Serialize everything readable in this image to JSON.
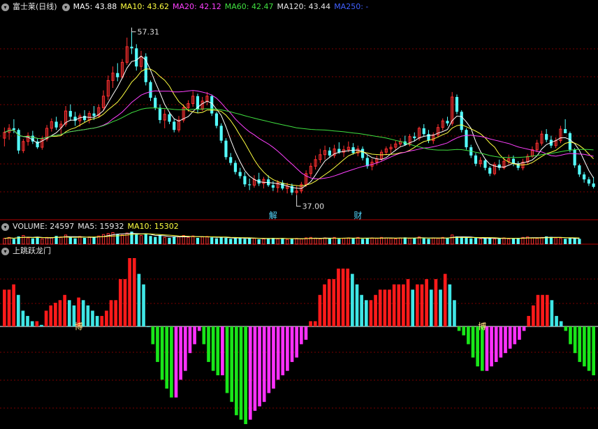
{
  "colors": {
    "up": "#ff3030",
    "down": "#54ffff",
    "ma5": "#ffffff",
    "ma10": "#ffff40",
    "ma20": "#ff40ff",
    "ma60": "#40e040",
    "ma120": "#dddddd",
    "ma250": "#4060ff",
    "ind_up_red": "#ff1a1a",
    "ind_up_cyan": "#3fe6e6",
    "ind_dn_green": "#19e619",
    "ind_dn_magenta": "#ff30ff"
  },
  "header": {
    "collapse_icon": "chevron-down-circle-icon",
    "title": "富士莱(日线)",
    "ma5": "MA5: 43.88",
    "ma10": "MA10: 43.62",
    "ma20": "MA20: 42.12",
    "ma60": "MA60: 42.47",
    "ma120": "MA120: 43.44",
    "ma250": "MA250: -"
  },
  "volume_header": {
    "vol": "VOLUME: 24597",
    "ma5": "MA5: 15932",
    "ma10": "MA10: 15302"
  },
  "indicator_header": {
    "title": "上跳跃龙门"
  },
  "chart_data": [
    {
      "type": "candlestick",
      "title": "富士莱(日线)",
      "price_range": [
        34.6,
        58.8
      ],
      "annotations": [
        {
          "label": "57.31",
          "kind": "high",
          "index": 27
        },
        {
          "label": "37.00",
          "kind": "low",
          "index": 62
        },
        {
          "label": "解",
          "index": 57
        },
        {
          "label": "财",
          "index": 75
        }
      ],
      "ohlc": [
        [
          43.9,
          45.2,
          42.9,
          44.6
        ],
        [
          44.6,
          45.6,
          43.7,
          45.1
        ],
        [
          45.1,
          46.2,
          44.5,
          44.9
        ],
        [
          44.9,
          45.1,
          42.0,
          42.4
        ],
        [
          42.4,
          43.8,
          42.1,
          43.5
        ],
        [
          43.5,
          44.6,
          43.0,
          44.2
        ],
        [
          44.2,
          44.8,
          43.2,
          43.5
        ],
        [
          43.5,
          43.9,
          42.6,
          42.8
        ],
        [
          42.8,
          44.1,
          42.5,
          43.8
        ],
        [
          43.8,
          45.5,
          43.5,
          45.1
        ],
        [
          45.1,
          46.3,
          44.7,
          45.9
        ],
        [
          45.9,
          46.5,
          44.9,
          45.2
        ],
        [
          45.2,
          46.0,
          44.2,
          45.6
        ],
        [
          45.6,
          47.8,
          45.3,
          47.2
        ],
        [
          47.2,
          48.0,
          46.0,
          46.5
        ],
        [
          46.5,
          47.1,
          45.4,
          46.0
        ],
        [
          46.0,
          46.9,
          45.3,
          46.6
        ],
        [
          46.6,
          47.3,
          45.8,
          46.1
        ],
        [
          46.1,
          47.2,
          45.7,
          46.9
        ],
        [
          46.9,
          47.8,
          46.1,
          46.6
        ],
        [
          46.6,
          48.0,
          46.4,
          47.6
        ],
        [
          47.6,
          49.7,
          47.2,
          49.0
        ],
        [
          49.0,
          51.5,
          48.5,
          50.9
        ],
        [
          50.9,
          52.6,
          50.0,
          51.8
        ],
        [
          51.8,
          53.0,
          50.8,
          51.3
        ],
        [
          51.3,
          53.5,
          51.1,
          53.1
        ],
        [
          53.1,
          56.1,
          52.8,
          55.0
        ],
        [
          55.0,
          57.31,
          54.1,
          54.8
        ],
        [
          54.8,
          55.3,
          52.1,
          52.6
        ],
        [
          52.6,
          54.5,
          52.1,
          53.8
        ],
        [
          53.8,
          54.2,
          50.3,
          50.7
        ],
        [
          50.7,
          50.9,
          48.4,
          48.8
        ],
        [
          48.8,
          49.1,
          47.3,
          47.6
        ],
        [
          47.6,
          48.0,
          45.7,
          46.1
        ],
        [
          46.1,
          47.4,
          45.1,
          46.8
        ],
        [
          46.8,
          47.1,
          45.6,
          45.9
        ],
        [
          45.9,
          46.3,
          44.6,
          44.9
        ],
        [
          44.9,
          46.6,
          44.6,
          46.1
        ],
        [
          46.1,
          48.0,
          45.8,
          47.6
        ],
        [
          47.6,
          48.5,
          47.1,
          48.1
        ],
        [
          48.1,
          49.6,
          47.7,
          49.0
        ],
        [
          49.0,
          49.3,
          47.0,
          47.4
        ],
        [
          47.4,
          48.9,
          47.2,
          48.4
        ],
        [
          48.4,
          49.5,
          47.9,
          49.0
        ],
        [
          49.0,
          49.2,
          46.6,
          46.9
        ],
        [
          46.9,
          47.1,
          45.1,
          45.4
        ],
        [
          45.4,
          45.7,
          43.3,
          43.6
        ],
        [
          43.6,
          43.9,
          41.3,
          41.6
        ],
        [
          41.6,
          42.1,
          40.6,
          40.9
        ],
        [
          40.9,
          41.2,
          39.5,
          39.8
        ],
        [
          39.8,
          40.3,
          39.0,
          39.3
        ],
        [
          39.3,
          39.8,
          38.0,
          38.3
        ],
        [
          38.3,
          39.0,
          37.6,
          38.2
        ],
        [
          38.2,
          39.4,
          37.9,
          38.9
        ],
        [
          38.9,
          39.7,
          38.1,
          38.4
        ],
        [
          38.4,
          39.2,
          37.8,
          38.9
        ],
        [
          38.9,
          39.4,
          38.0,
          38.2
        ],
        [
          38.2,
          38.7,
          37.5,
          37.9
        ],
        [
          37.9,
          38.8,
          37.3,
          38.5
        ],
        [
          38.5,
          38.8,
          37.6,
          37.8
        ],
        [
          37.8,
          38.5,
          37.2,
          38.1
        ],
        [
          38.1,
          38.4,
          37.0,
          37.3
        ],
        [
          37.3,
          38.1,
          37.0,
          37.5
        ],
        [
          37.5,
          38.6,
          37.2,
          38.3
        ],
        [
          38.3,
          40.0,
          38.0,
          39.6
        ],
        [
          39.6,
          40.9,
          39.2,
          40.5
        ],
        [
          40.5,
          41.8,
          40.1,
          41.3
        ],
        [
          41.3,
          42.6,
          40.9,
          41.9
        ],
        [
          41.9,
          43.0,
          41.3,
          42.4
        ],
        [
          42.4,
          42.8,
          41.5,
          41.8
        ],
        [
          41.8,
          43.1,
          41.5,
          42.6
        ],
        [
          42.6,
          43.4,
          42.0,
          42.2
        ],
        [
          42.2,
          43.0,
          41.6,
          42.5
        ],
        [
          42.5,
          43.5,
          42.2,
          42.8
        ],
        [
          42.8,
          43.3,
          41.9,
          42.1
        ],
        [
          42.1,
          43.0,
          41.7,
          42.6
        ],
        [
          42.6,
          42.9,
          41.2,
          41.5
        ],
        [
          41.5,
          41.9,
          40.2,
          40.5
        ],
        [
          40.5,
          41.4,
          40.0,
          41.0
        ],
        [
          41.0,
          41.8,
          40.6,
          41.4
        ],
        [
          41.4,
          42.5,
          41.1,
          42.2
        ],
        [
          42.2,
          42.9,
          41.8,
          42.6
        ],
        [
          42.6,
          43.2,
          42.1,
          42.8
        ],
        [
          42.8,
          43.6,
          42.4,
          43.2
        ],
        [
          43.2,
          43.9,
          42.8,
          43.5
        ],
        [
          43.5,
          44.2,
          43.0,
          43.1
        ],
        [
          43.1,
          44.4,
          42.9,
          44.1
        ],
        [
          44.1,
          44.6,
          43.5,
          43.9
        ],
        [
          43.9,
          45.3,
          43.6,
          45.1
        ],
        [
          45.1,
          45.6,
          44.1,
          44.4
        ],
        [
          44.4,
          44.9,
          43.3,
          43.6
        ],
        [
          43.6,
          44.6,
          43.2,
          44.3
        ],
        [
          44.3,
          45.6,
          44.0,
          45.2
        ],
        [
          45.2,
          46.3,
          44.8,
          46.0
        ],
        [
          46.0,
          46.5,
          45.4,
          45.7
        ],
        [
          45.7,
          49.5,
          45.4,
          48.9
        ],
        [
          48.9,
          49.2,
          46.8,
          47.1
        ],
        [
          47.1,
          47.3,
          44.6,
          44.9
        ],
        [
          44.9,
          45.1,
          42.5,
          42.8
        ],
        [
          42.8,
          43.1,
          41.5,
          41.8
        ],
        [
          41.8,
          42.1,
          40.5,
          40.8
        ],
        [
          40.8,
          41.6,
          40.4,
          41.2
        ],
        [
          41.2,
          41.4,
          40.0,
          40.3
        ],
        [
          40.3,
          40.5,
          39.3,
          39.6
        ],
        [
          39.6,
          41.0,
          39.4,
          40.7
        ],
        [
          40.7,
          41.3,
          40.0,
          40.3
        ],
        [
          40.3,
          41.6,
          40.1,
          41.1
        ],
        [
          41.1,
          41.9,
          40.7,
          41.4
        ],
        [
          41.4,
          41.8,
          40.5,
          40.8
        ],
        [
          40.8,
          41.1,
          40.0,
          40.3
        ],
        [
          40.3,
          41.4,
          40.0,
          41.0
        ],
        [
          41.0,
          42.0,
          40.7,
          41.7
        ],
        [
          41.7,
          42.9,
          41.5,
          42.5
        ],
        [
          42.5,
          43.7,
          42.2,
          43.3
        ],
        [
          43.3,
          44.8,
          43.0,
          44.4
        ],
        [
          44.4,
          45.0,
          43.4,
          43.7
        ],
        [
          43.7,
          44.2,
          42.7,
          43.0
        ],
        [
          43.0,
          44.0,
          42.7,
          43.6
        ],
        [
          43.6,
          45.4,
          43.3,
          45.0
        ],
        [
          45.0,
          46.2,
          44.5,
          44.5
        ],
        [
          44.5,
          44.7,
          42.2,
          42.5
        ],
        [
          42.5,
          42.7,
          40.3,
          40.6
        ],
        [
          40.6,
          40.8,
          39.2,
          39.5
        ],
        [
          39.5,
          39.8,
          38.5,
          38.9
        ],
        [
          38.9,
          39.2,
          38.1,
          38.4
        ],
        [
          38.4,
          39.2,
          37.8,
          38.0
        ]
      ]
    },
    {
      "type": "bar",
      "title": "VOLUME",
      "series": [
        {
          "name": "VOLUME",
          "values": [
            12,
            14,
            11,
            16,
            18,
            13,
            12,
            15,
            11,
            14,
            13,
            17,
            15,
            19,
            14,
            12,
            16,
            13,
            15,
            14,
            17,
            20,
            22,
            24,
            21,
            19,
            23,
            26,
            20,
            18,
            21,
            17,
            15,
            19,
            14,
            13,
            16,
            15,
            18,
            14,
            17,
            13,
            15,
            16,
            14,
            12,
            15,
            13,
            11,
            12,
            14,
            11,
            13,
            12,
            10,
            11,
            12,
            13,
            11,
            12,
            10,
            11,
            12,
            11,
            13,
            14,
            12,
            11,
            13,
            12,
            14,
            11,
            12,
            13,
            12,
            14,
            11,
            12,
            13,
            12,
            14,
            13,
            12,
            11,
            13,
            14,
            12,
            13,
            15,
            12,
            11,
            13,
            12,
            14,
            13,
            19,
            16,
            14,
            13,
            12,
            13,
            11,
            12,
            13,
            11,
            12,
            13,
            11,
            12,
            13,
            14,
            15,
            13,
            12,
            14,
            16,
            15,
            13,
            12,
            11,
            12,
            13,
            11
          ]
        },
        {
          "name": "MA5",
          "values": []
        },
        {
          "name": "MA10",
          "values": []
        }
      ],
      "labels": {
        "VOLUME": "24597",
        "MA5": "15932",
        "MA10": "15302"
      }
    },
    {
      "type": "bar",
      "title": "上跳跃龙门",
      "markers": [
        {
          "label": "博",
          "index": 16
        },
        {
          "label": "博",
          "index": 103
        }
      ],
      "values": [
        7,
        7,
        8,
        6,
        3,
        2,
        1,
        1,
        0.3,
        3,
        4,
        4.5,
        5,
        6,
        5,
        4,
        5.5,
        5,
        4,
        3,
        2,
        2,
        3,
        5,
        5,
        9,
        9,
        13,
        13,
        10,
        8,
        0,
        -4,
        -8,
        -12,
        -14,
        -16,
        -16,
        -12,
        -10,
        -6,
        -4,
        -1,
        -4,
        -8,
        -10,
        -11,
        -11,
        -15,
        -17,
        -20,
        -21,
        -22,
        -21,
        -19,
        -18,
        -17,
        -15,
        -14,
        -12,
        -11,
        -10,
        -8,
        -7,
        -4,
        -3,
        1,
        1,
        6,
        8,
        9,
        9,
        11,
        11,
        11,
        10,
        8,
        6,
        5,
        5,
        6,
        7,
        7,
        7,
        8,
        8,
        8,
        9,
        7,
        8,
        8,
        9,
        7,
        9,
        7,
        10,
        8,
        5,
        -1,
        -2,
        -4,
        -7,
        -9,
        -10,
        -10,
        -9,
        -8,
        -7,
        -6,
        -5,
        -4,
        -3,
        -1,
        2,
        4,
        6,
        6,
        6,
        5,
        2,
        1,
        -1,
        -4,
        -6,
        -8,
        -9,
        -10,
        -11
      ]
    }
  ]
}
